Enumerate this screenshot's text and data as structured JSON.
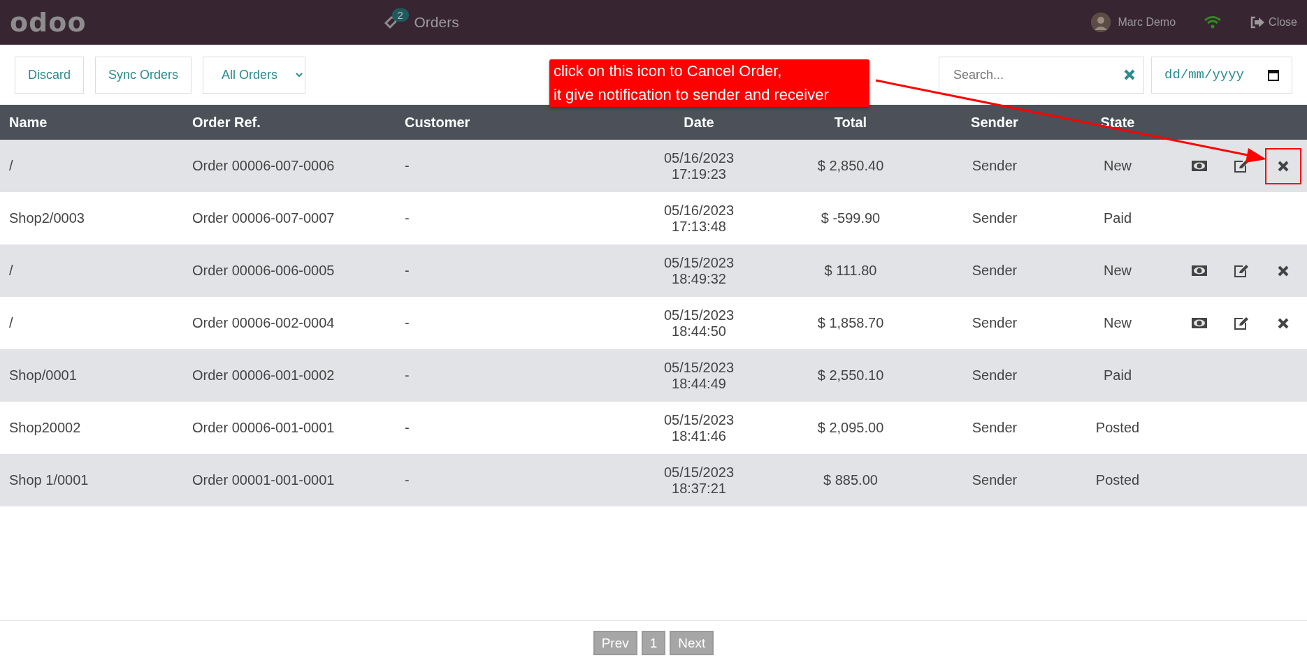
{
  "topbar": {
    "logo": "odoo",
    "orders_badge": "2",
    "orders_label": "Orders",
    "user": "Marc Demo",
    "close": "Close"
  },
  "toolbar": {
    "buttons": [
      "Discard",
      "Sync Orders"
    ],
    "filter": "All Orders",
    "search": {
      "placeholder": "Search..."
    },
    "date": {
      "placeholder": "dd/mm/yyyy"
    }
  },
  "callout": {
    "lines": [
      "click on this icon to Cancel Order,",
      "it give notification to sender and receiver"
    ]
  },
  "table": {
    "columns": [
      "Name",
      "Order Ref.",
      "Customer",
      "Date",
      "Total",
      "Sender",
      "State"
    ],
    "rows": [
      {
        "name": "/",
        "order_ref": "Order 00006-007-0006",
        "customer": "-",
        "date": "05/16/2023",
        "time": "17:19:23",
        "total": "$ 2,850.40",
        "sender": "Sender",
        "state": "New",
        "actions": true,
        "highlighted": true
      },
      {
        "name": "Shop2/0003",
        "order_ref": "Order 00006-007-0007",
        "customer": "-",
        "date": "05/16/2023",
        "time": "17:13:48",
        "total": "$ -599.90",
        "sender": "Sender",
        "state": "Paid",
        "actions": false
      },
      {
        "name": "/",
        "order_ref": "Order 00006-006-0005",
        "customer": "-",
        "date": "05/15/2023",
        "time": "18:49:32",
        "total": "$ 111.80",
        "sender": "Sender",
        "state": "New",
        "actions": true,
        "highlighted": false
      },
      {
        "name": "/",
        "order_ref": "Order 00006-002-0004",
        "customer": "-",
        "date": "05/15/2023",
        "time": "18:44:50",
        "total": "$ 1,858.70",
        "sender": "Sender",
        "state": "New",
        "actions": true,
        "highlighted": false
      },
      {
        "name": "Shop/0001",
        "order_ref": "Order 00006-001-0002",
        "customer": "-",
        "date": "05/15/2023",
        "time": "18:44:49",
        "total": "$ 2,550.10",
        "sender": "Sender",
        "state": "Paid",
        "actions": false
      },
      {
        "name": "Shop20002",
        "order_ref": "Order 00006-001-0001",
        "customer": "-",
        "date": "05/15/2023",
        "time": "18:41:46",
        "total": "$ 2,095.00",
        "sender": "Sender",
        "state": "Posted",
        "actions": false
      },
      {
        "name": "Shop 1/0001",
        "order_ref": "Order 00001-001-0001",
        "customer": "-",
        "date": "05/15/2023",
        "time": "18:37:21",
        "total": "$ 885.00",
        "sender": "Sender",
        "state": "Posted",
        "actions": false
      }
    ]
  },
  "pagination": {
    "prev": "Prev",
    "pages": [
      "1"
    ],
    "next": "Next"
  }
}
